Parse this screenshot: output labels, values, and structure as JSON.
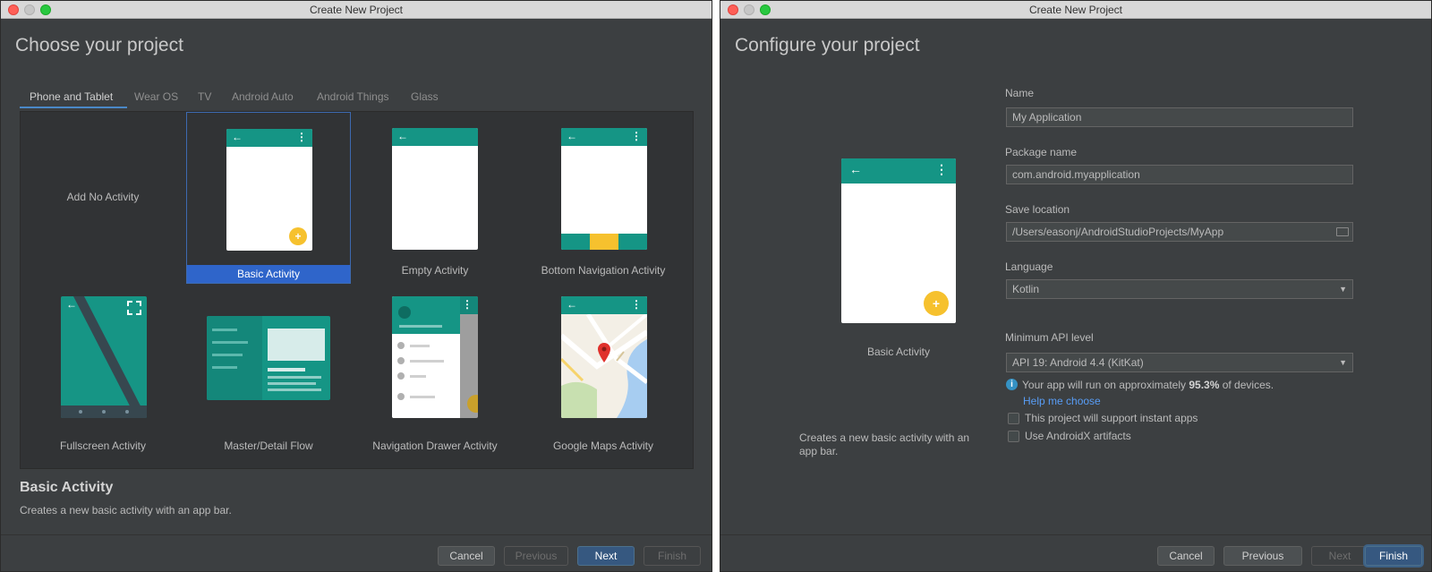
{
  "left_window": {
    "window_title": "Create New Project",
    "page_title": "Choose your project",
    "tabs": [
      "Phone and Tablet",
      "Wear OS",
      "TV",
      "Android Auto",
      "Android Things",
      "Glass"
    ],
    "templates": [
      {
        "label": "Add No Activity"
      },
      {
        "label": "Basic Activity",
        "selected": true
      },
      {
        "label": "Empty Activity"
      },
      {
        "label": "Bottom Navigation Activity"
      },
      {
        "label": "Fullscreen Activity"
      },
      {
        "label": "Master/Detail Flow"
      },
      {
        "label": "Navigation Drawer Activity"
      },
      {
        "label": "Google Maps Activity"
      }
    ],
    "description_title": "Basic Activity",
    "description_text": "Creates a new basic activity with an app bar.",
    "buttons": {
      "cancel": "Cancel",
      "previous": "Previous",
      "next": "Next",
      "finish": "Finish"
    }
  },
  "right_window": {
    "window_title": "Create New Project",
    "page_title": "Configure your project",
    "preview_label": "Basic Activity",
    "preview_description": "Creates a new basic activity with an app bar.",
    "fields": {
      "name_label": "Name",
      "name_value": "My Application",
      "package_label": "Package name",
      "package_value": "com.android.myapplication",
      "location_label": "Save location",
      "location_value": "/Users/easonj/AndroidStudioProjects/MyApp",
      "language_label": "Language",
      "language_value": "Kotlin",
      "api_label": "Minimum API level",
      "api_value": "API 19: Android 4.4 (KitKat)"
    },
    "info": {
      "prefix": "Your app will run on approximately",
      "percent": "95.3%",
      "suffix": "of devices."
    },
    "help_link": "Help me choose",
    "checkboxes": [
      {
        "label": "This project will support instant apps",
        "checked": false
      },
      {
        "label": "Use AndroidX artifacts",
        "checked": false
      }
    ],
    "buttons": {
      "cancel": "Cancel",
      "previous": "Previous",
      "next": "Next",
      "finish": "Finish"
    }
  },
  "colors": {
    "app_bar": "#159585",
    "fab": "#f6c12e",
    "selection": "#2f65ca",
    "link": "#589df6",
    "primary_button": "#365880"
  },
  "icons": [
    "back-arrow-icon",
    "overflow-menu-icon",
    "plus-icon",
    "expand-icon",
    "map-pin-icon",
    "folder-icon",
    "info-icon",
    "dropdown-caret-icon"
  ]
}
